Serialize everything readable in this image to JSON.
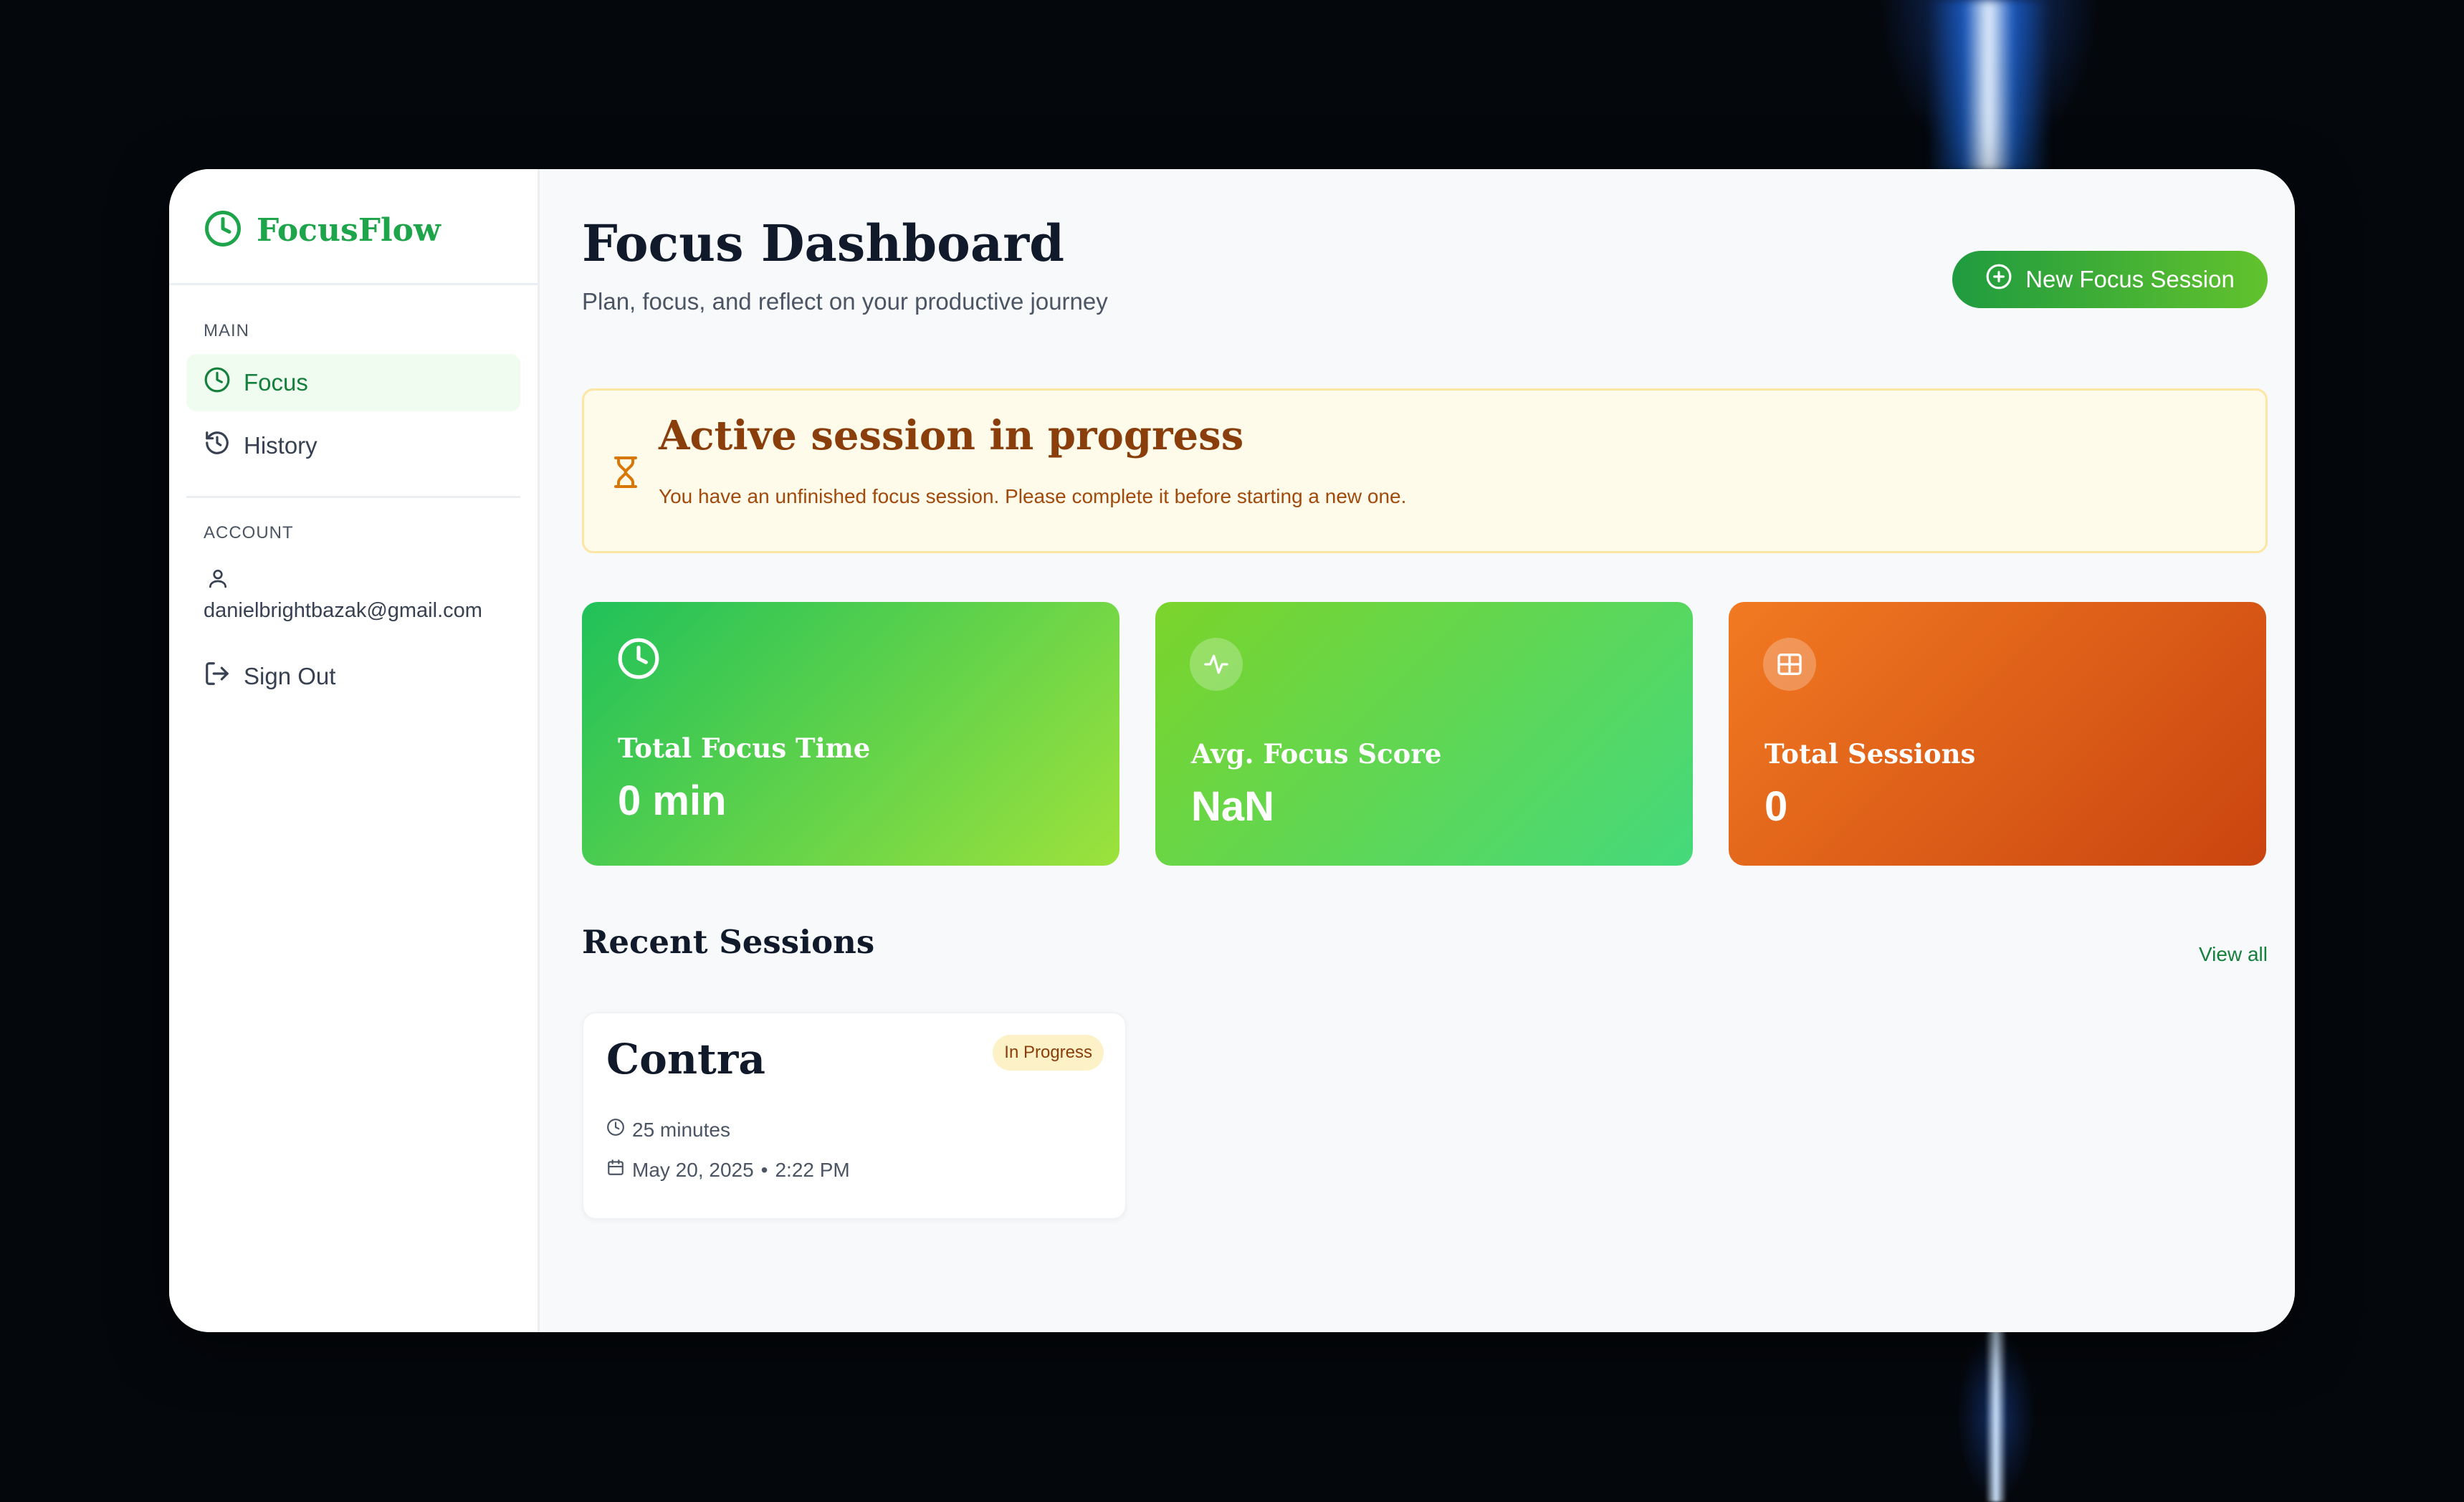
{
  "app": {
    "name": "FocusFlow"
  },
  "sidebar": {
    "main_label": "MAIN",
    "items": [
      {
        "label": "Focus",
        "icon": "clock-icon",
        "active": true
      },
      {
        "label": "History",
        "icon": "history-icon",
        "active": false
      }
    ],
    "account_label": "ACCOUNT",
    "email": "danielbrightbazak@gmail.com",
    "sign_out": "Sign Out"
  },
  "header": {
    "title": "Focus Dashboard",
    "subtitle": "Plan, focus, and reflect on your productive journey",
    "new_session_button": "New Focus Session"
  },
  "alert": {
    "title": "Active session in progress",
    "message": "You have an unfinished focus session. Please complete it before starting a new one."
  },
  "stats": [
    {
      "title": "Total Focus Time",
      "value": "0 min",
      "icon": "clock-icon"
    },
    {
      "title": "Avg. Focus Score",
      "value": "NaN",
      "icon": "activity-icon"
    },
    {
      "title": "Total Sessions",
      "value": "0",
      "icon": "grid-icon"
    }
  ],
  "recent": {
    "title": "Recent Sessions",
    "view_all": "View all",
    "sessions": [
      {
        "name": "Contra",
        "status": "In Progress",
        "duration": "25 minutes",
        "date": "May 20, 2025",
        "time": "2:22 PM"
      }
    ]
  },
  "colors": {
    "brand_green": "#1ea44a",
    "alert_bg": "#fefbeb",
    "alert_text": "#8a3e0b",
    "card_orange": "#f27a22"
  }
}
